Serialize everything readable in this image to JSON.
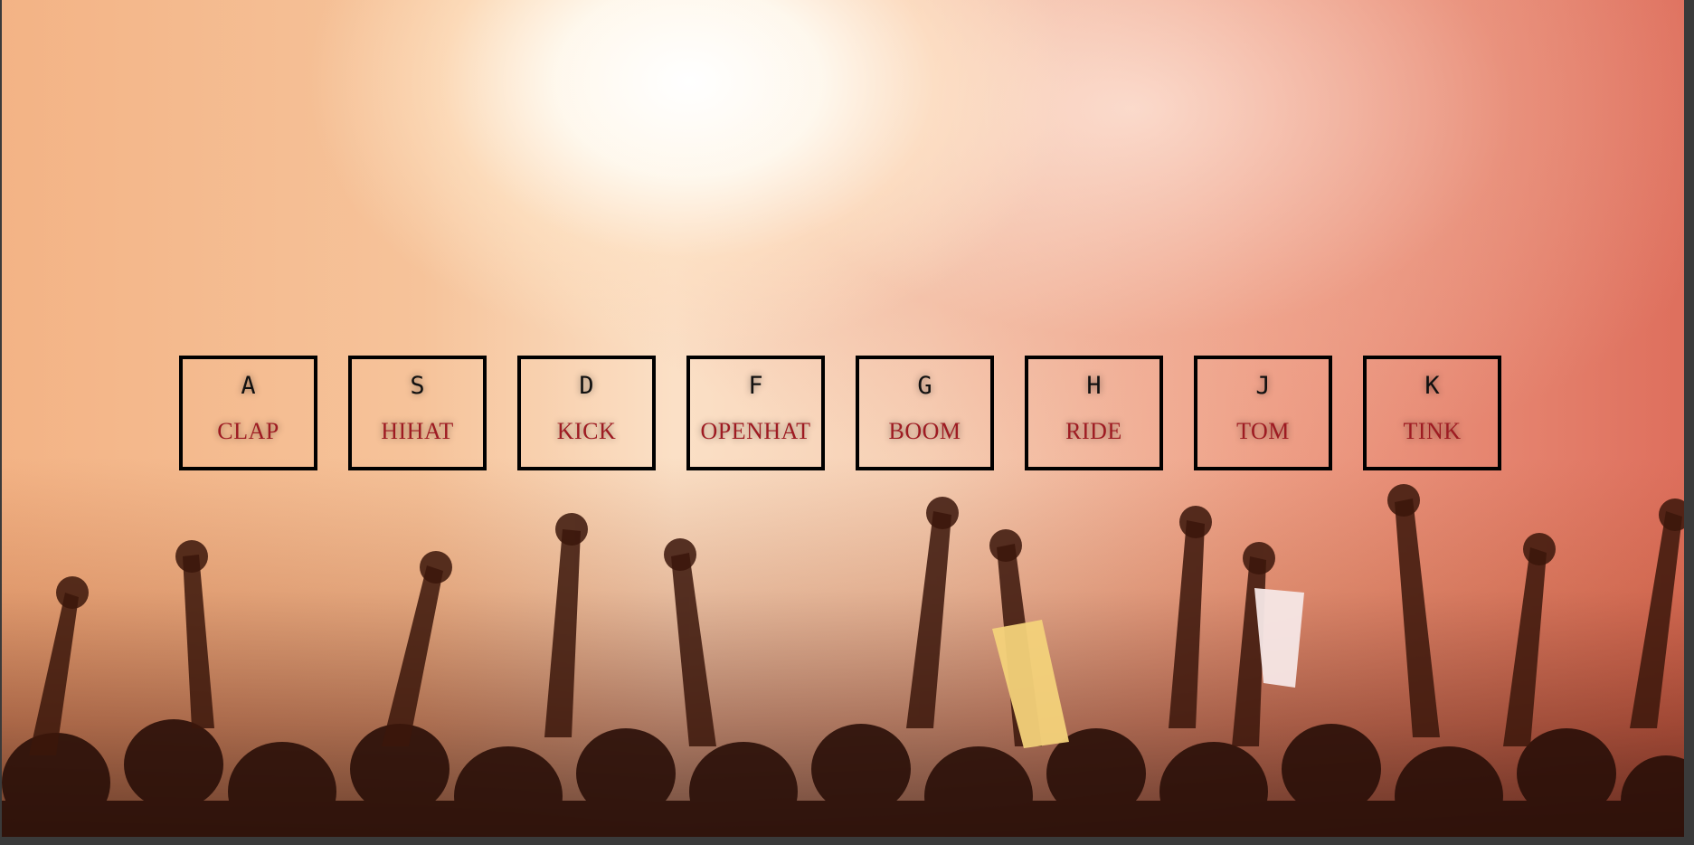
{
  "keys": [
    {
      "letter": "A",
      "sound": "CLAP"
    },
    {
      "letter": "S",
      "sound": "HIHAT"
    },
    {
      "letter": "D",
      "sound": "KICK"
    },
    {
      "letter": "F",
      "sound": "OPENHAT"
    },
    {
      "letter": "G",
      "sound": "BOOM"
    },
    {
      "letter": "H",
      "sound": "RIDE"
    },
    {
      "letter": "J",
      "sound": "TOM"
    },
    {
      "letter": "K",
      "sound": "TINK"
    }
  ],
  "background": {
    "scene": "concert-crowd-image",
    "colors": {
      "glow": "#fff8ef",
      "warm": "#f3b385",
      "red": "#de6f5d",
      "silhouette": "#2a0f08"
    }
  },
  "colors": {
    "border": "#000000",
    "letter": "#111111",
    "sound": "#9e1b22"
  }
}
